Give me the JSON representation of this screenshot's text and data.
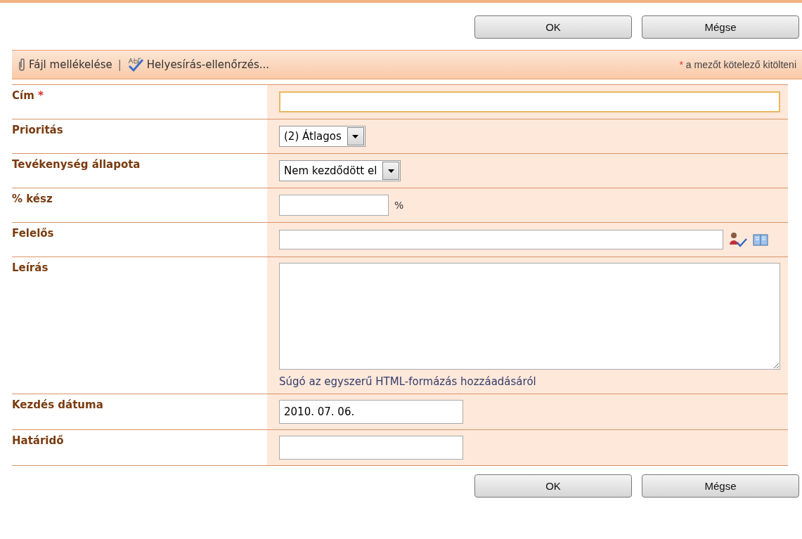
{
  "top_buttons": [
    "OK",
    "Mégse"
  ],
  "toolbar": {
    "attach": "Fájl mellékelése",
    "separator": "|",
    "spellcheck": "Helyesírás-ellenőrzés...",
    "required_mark": "*",
    "required_note": "a mezőt kötelező kitölteni"
  },
  "fields": [
    {
      "kind": "text",
      "label": "Cím",
      "required_mark": "*",
      "focused": true
    },
    {
      "kind": "select",
      "label": "Prioritás",
      "value": "(2) Átlagos"
    },
    {
      "kind": "select",
      "label": "Tevékenység állapota",
      "value": "Nem kezdődött el"
    },
    {
      "kind": "percent",
      "label": "% kész",
      "unit": "%"
    },
    {
      "kind": "people",
      "label": "Felelős"
    },
    {
      "kind": "textarea",
      "label": "Leírás",
      "help_link": "Súgó az egyszerű HTML-formázás hozzáadásáról"
    },
    {
      "kind": "date",
      "label": "Kezdés dátuma",
      "value": "2010. 07. 06."
    },
    {
      "kind": "date",
      "label": "Határidő"
    }
  ],
  "bottom_buttons": [
    "OK",
    "Mégse"
  ]
}
